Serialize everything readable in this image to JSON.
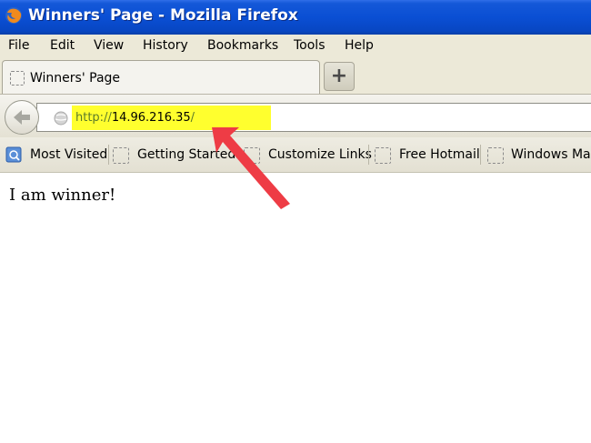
{
  "window": {
    "title": "Winners' Page - Mozilla Firefox"
  },
  "menubar": {
    "items": [
      "File",
      "Edit",
      "View",
      "History",
      "Bookmarks",
      "Tools",
      "Help"
    ]
  },
  "tabs": [
    {
      "label": "Winners' Page",
      "active": true
    }
  ],
  "newtab": {
    "label": "+"
  },
  "urlbar": {
    "scheme": "http://",
    "host": "14.96.216.35",
    "path": "/"
  },
  "bookmarks": [
    {
      "label": "Most Visited",
      "icon": "smart-bookmark-icon"
    },
    {
      "label": "Getting Started",
      "icon": "favicon-placeholder-icon"
    },
    {
      "label": "Customize Links",
      "icon": "favicon-placeholder-icon"
    },
    {
      "label": "Free Hotmail",
      "icon": "favicon-placeholder-icon"
    },
    {
      "label": "Windows Marketplace",
      "icon": "favicon-placeholder-icon"
    }
  ],
  "page": {
    "body_text": "I am winner!"
  },
  "colors": {
    "titlebar": "#0a4fd4",
    "url_highlight": "#ffff2e",
    "annotation_arrow": "#ee3c45"
  }
}
